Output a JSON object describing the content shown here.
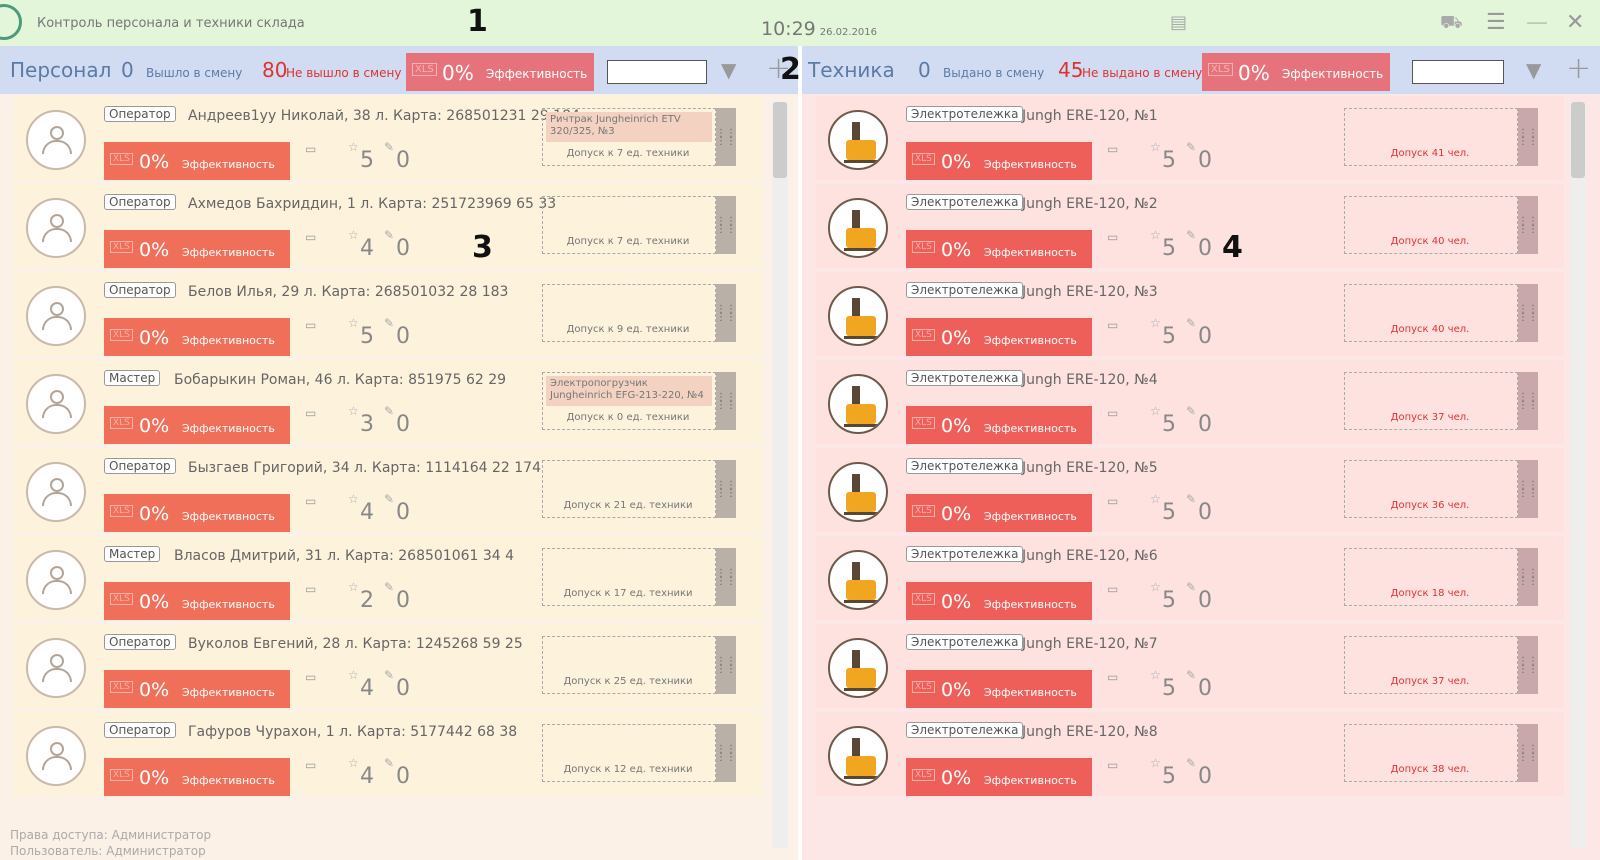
{
  "app": {
    "title": "Контроль персонала и техники склада",
    "time": "10:29",
    "date": "26.02.2016"
  },
  "markers": [
    "1",
    "2",
    "3",
    "4"
  ],
  "personnel": {
    "title": "Персонал",
    "out_count": "0",
    "out_label": "Вышло в смену",
    "notout_count": "80",
    "notout_label": "Не вышло в смену",
    "eff_pct": "0%",
    "eff_label": "Эффективность",
    "cards": [
      {
        "role": "Оператор",
        "name": "Андреев1уу Николай, 38 л. Карта: 268501231 29  184",
        "stars": "5",
        "edits": "0",
        "tag": "Ричтрак Jungheinrich ETV 320/325, №3",
        "access": "Допуск к  7 ед. техники"
      },
      {
        "role": "Оператор",
        "name": "Ахмедов Бахриддин, 1 л. Карта: 251723969 65  33",
        "stars": "4",
        "edits": "0",
        "tag": "",
        "access": "Допуск к  7 ед. техники"
      },
      {
        "role": "Оператор",
        "name": "Белов Илья, 29 л. Карта: 268501032 28  183",
        "stars": "5",
        "edits": "0",
        "tag": "",
        "access": "Допуск к  9 ед. техники"
      },
      {
        "role": "Мастер",
        "name": "Бобарыкин Роман, 46 л. Карта: 851975 62  29",
        "stars": "3",
        "edits": "0",
        "tag": "Электропогрузчик Jungheinrich EFG-213-220, №4",
        "access": "Допуск к  0 ед. техники"
      },
      {
        "role": "Оператор",
        "name": "Бызгаев Григорий, 34 л. Карта: 1114164 22  174",
        "stars": "4",
        "edits": "0",
        "tag": "",
        "access": "Допуск к  21 ед. техники"
      },
      {
        "role": "Мастер",
        "name": "Власов Дмитрий, 31 л. Карта: 268501061 34  4",
        "stars": "2",
        "edits": "0",
        "tag": "",
        "access": "Допуск к  17 ед. техники"
      },
      {
        "role": "Оператор",
        "name": "Вуколов Евгений, 28 л. Карта: 1245268 59  25",
        "stars": "4",
        "edits": "0",
        "tag": "",
        "access": "Допуск к  25 ед. техники"
      },
      {
        "role": "Оператор",
        "name": "Гафуров Чурахон, 1 л. Карта: 5177442 68  38",
        "stars": "4",
        "edits": "0",
        "tag": "",
        "access": "Допуск к  12 ед. техники"
      }
    ]
  },
  "equipment": {
    "title": "Техника",
    "out_count": "0",
    "out_label": "Выдано в смену",
    "notout_count": "45",
    "notout_label": "Не выдано в смену",
    "eff_pct": "0%",
    "eff_label": "Эффективность",
    "cards": [
      {
        "role": "Электротележка",
        "name": "Jungh ERE-120, №1",
        "stars": "5",
        "edits": "0",
        "access": "Допуск 41 чел."
      },
      {
        "role": "Электротележка",
        "name": "Jungh ERE-120, №2",
        "stars": "5",
        "edits": "0",
        "access": "Допуск 40 чел."
      },
      {
        "role": "Электротележка",
        "name": "Jungh ERE-120, №3",
        "stars": "5",
        "edits": "0",
        "access": "Допуск 40 чел."
      },
      {
        "role": "Электротележка",
        "name": "Jungh ERE-120, №4",
        "stars": "5",
        "edits": "0",
        "access": "Допуск 37 чел."
      },
      {
        "role": "Электротележка",
        "name": "Jungh ERE-120, №5",
        "stars": "5",
        "edits": "0",
        "access": "Допуск 36 чел."
      },
      {
        "role": "Электротележка",
        "name": "Jungh ERE-120, №6",
        "stars": "5",
        "edits": "0",
        "access": "Допуск 18 чел."
      },
      {
        "role": "Электротележка",
        "name": "Jungh ERE-120, №7",
        "stars": "5",
        "edits": "0",
        "access": "Допуск 37 чел."
      },
      {
        "role": "Электротележка",
        "name": "Jungh ERE-120, №8",
        "stars": "5",
        "edits": "0",
        "access": "Допуск 38 чел."
      }
    ]
  },
  "card_labels": {
    "pct": "0%",
    "eff": "Эффективность",
    "xls": "XLS"
  },
  "status": {
    "rights": "Права доступа: Администратор",
    "user": "Пользователь: Администратор"
  },
  "colors": {
    "accent": "#e6737b",
    "card_eff": "#ef6f59",
    "header_bg": "#d1dcf3",
    "title_bg": "#e3f6d9"
  }
}
